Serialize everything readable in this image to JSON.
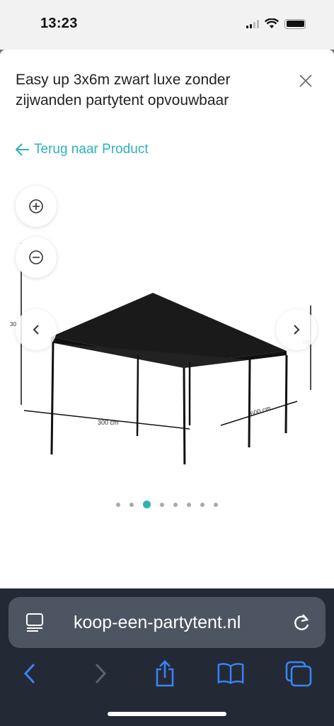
{
  "status_bar": {
    "time": "13:23"
  },
  "modal": {
    "title": "Easy up 3x6m zwart luxe zonder zijwanden partytent opvouwbaar",
    "back_link": "Terug naar Product",
    "close_icon": "close-icon"
  },
  "gallery": {
    "dimension_labels": {
      "width": "300 cm",
      "length": "600 cm",
      "height_left": "300 cm",
      "height_right": "195 cm"
    },
    "slide_count": 8,
    "active_slide": 3
  },
  "browser": {
    "url": "koop-een-partytent.nl"
  },
  "colors": {
    "accent": "#2ab3b8",
    "browser_blue": "#3b82f6"
  }
}
